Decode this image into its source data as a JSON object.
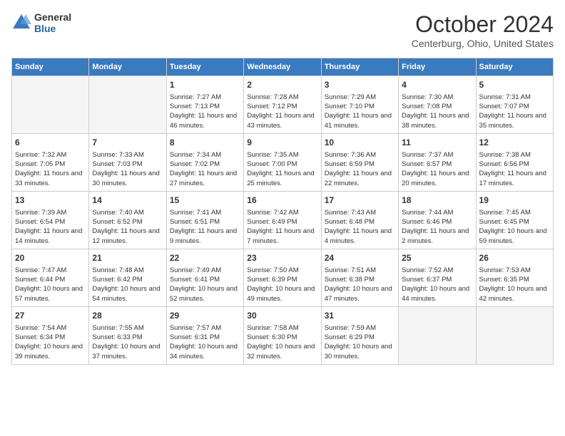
{
  "header": {
    "logo": {
      "general": "General",
      "blue": "Blue"
    },
    "title": "October 2024",
    "location": "Centerburg, Ohio, United States"
  },
  "weekdays": [
    "Sunday",
    "Monday",
    "Tuesday",
    "Wednesday",
    "Thursday",
    "Friday",
    "Saturday"
  ],
  "weeks": [
    [
      {
        "num": "",
        "empty": true
      },
      {
        "num": "",
        "empty": true
      },
      {
        "num": "1",
        "sunrise": "7:27 AM",
        "sunset": "7:13 PM",
        "daylight": "11 hours and 46 minutes."
      },
      {
        "num": "2",
        "sunrise": "7:28 AM",
        "sunset": "7:12 PM",
        "daylight": "11 hours and 43 minutes."
      },
      {
        "num": "3",
        "sunrise": "7:29 AM",
        "sunset": "7:10 PM",
        "daylight": "11 hours and 41 minutes."
      },
      {
        "num": "4",
        "sunrise": "7:30 AM",
        "sunset": "7:08 PM",
        "daylight": "11 hours and 38 minutes."
      },
      {
        "num": "5",
        "sunrise": "7:31 AM",
        "sunset": "7:07 PM",
        "daylight": "11 hours and 35 minutes."
      }
    ],
    [
      {
        "num": "6",
        "sunrise": "7:32 AM",
        "sunset": "7:05 PM",
        "daylight": "11 hours and 33 minutes."
      },
      {
        "num": "7",
        "sunrise": "7:33 AM",
        "sunset": "7:03 PM",
        "daylight": "11 hours and 30 minutes."
      },
      {
        "num": "8",
        "sunrise": "7:34 AM",
        "sunset": "7:02 PM",
        "daylight": "11 hours and 27 minutes."
      },
      {
        "num": "9",
        "sunrise": "7:35 AM",
        "sunset": "7:00 PM",
        "daylight": "11 hours and 25 minutes."
      },
      {
        "num": "10",
        "sunrise": "7:36 AM",
        "sunset": "6:59 PM",
        "daylight": "11 hours and 22 minutes."
      },
      {
        "num": "11",
        "sunrise": "7:37 AM",
        "sunset": "6:57 PM",
        "daylight": "11 hours and 20 minutes."
      },
      {
        "num": "12",
        "sunrise": "7:38 AM",
        "sunset": "6:56 PM",
        "daylight": "11 hours and 17 minutes."
      }
    ],
    [
      {
        "num": "13",
        "sunrise": "7:39 AM",
        "sunset": "6:54 PM",
        "daylight": "11 hours and 14 minutes."
      },
      {
        "num": "14",
        "sunrise": "7:40 AM",
        "sunset": "6:52 PM",
        "daylight": "11 hours and 12 minutes."
      },
      {
        "num": "15",
        "sunrise": "7:41 AM",
        "sunset": "6:51 PM",
        "daylight": "11 hours and 9 minutes."
      },
      {
        "num": "16",
        "sunrise": "7:42 AM",
        "sunset": "6:49 PM",
        "daylight": "11 hours and 7 minutes."
      },
      {
        "num": "17",
        "sunrise": "7:43 AM",
        "sunset": "6:48 PM",
        "daylight": "11 hours and 4 minutes."
      },
      {
        "num": "18",
        "sunrise": "7:44 AM",
        "sunset": "6:46 PM",
        "daylight": "11 hours and 2 minutes."
      },
      {
        "num": "19",
        "sunrise": "7:45 AM",
        "sunset": "6:45 PM",
        "daylight": "10 hours and 59 minutes."
      }
    ],
    [
      {
        "num": "20",
        "sunrise": "7:47 AM",
        "sunset": "6:44 PM",
        "daylight": "10 hours and 57 minutes."
      },
      {
        "num": "21",
        "sunrise": "7:48 AM",
        "sunset": "6:42 PM",
        "daylight": "10 hours and 54 minutes."
      },
      {
        "num": "22",
        "sunrise": "7:49 AM",
        "sunset": "6:41 PM",
        "daylight": "10 hours and 52 minutes."
      },
      {
        "num": "23",
        "sunrise": "7:50 AM",
        "sunset": "6:39 PM",
        "daylight": "10 hours and 49 minutes."
      },
      {
        "num": "24",
        "sunrise": "7:51 AM",
        "sunset": "6:38 PM",
        "daylight": "10 hours and 47 minutes."
      },
      {
        "num": "25",
        "sunrise": "7:52 AM",
        "sunset": "6:37 PM",
        "daylight": "10 hours and 44 minutes."
      },
      {
        "num": "26",
        "sunrise": "7:53 AM",
        "sunset": "6:35 PM",
        "daylight": "10 hours and 42 minutes."
      }
    ],
    [
      {
        "num": "27",
        "sunrise": "7:54 AM",
        "sunset": "6:34 PM",
        "daylight": "10 hours and 39 minutes."
      },
      {
        "num": "28",
        "sunrise": "7:55 AM",
        "sunset": "6:33 PM",
        "daylight": "10 hours and 37 minutes."
      },
      {
        "num": "29",
        "sunrise": "7:57 AM",
        "sunset": "6:31 PM",
        "daylight": "10 hours and 34 minutes."
      },
      {
        "num": "30",
        "sunrise": "7:58 AM",
        "sunset": "6:30 PM",
        "daylight": "10 hours and 32 minutes."
      },
      {
        "num": "31",
        "sunrise": "7:59 AM",
        "sunset": "6:29 PM",
        "daylight": "10 hours and 30 minutes."
      },
      {
        "num": "",
        "empty": true
      },
      {
        "num": "",
        "empty": true
      }
    ]
  ],
  "labels": {
    "sunrise": "Sunrise:",
    "sunset": "Sunset:",
    "daylight": "Daylight:"
  }
}
